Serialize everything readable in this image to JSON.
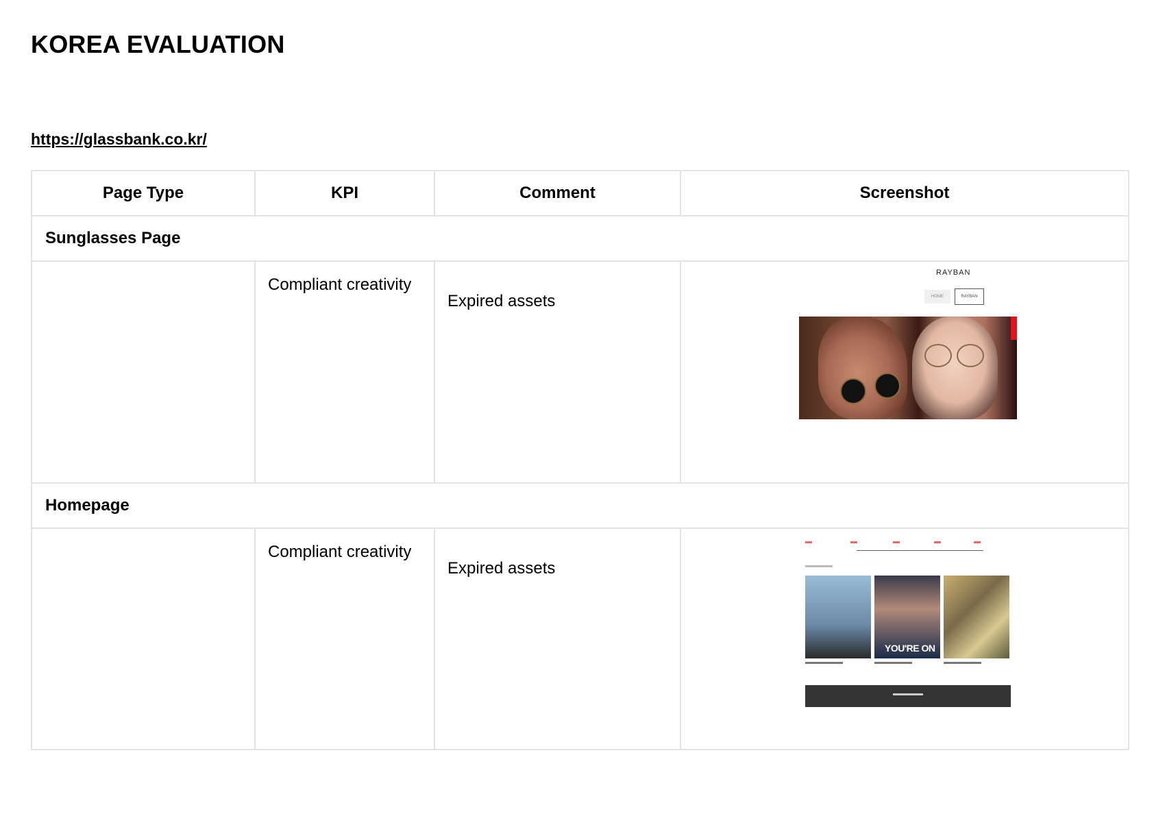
{
  "document": {
    "title": "KOREA EVALUATION",
    "url": "https://glassbank.co.kr/"
  },
  "table": {
    "headers": {
      "page_type": "Page Type",
      "kpi": "KPI",
      "comment": "Comment",
      "screenshot": "Screenshot"
    },
    "sections": [
      {
        "name": "Sunglasses Page",
        "page_type": "",
        "kpi": "Compliant creativity",
        "comment": "Expired assets",
        "screenshot": {
          "brand_text": "RAYBAN",
          "buttons": [
            "HOME",
            "RAYBAN"
          ]
        }
      },
      {
        "name": "Homepage",
        "page_type": "",
        "kpi": "Compliant creativity",
        "comment": "Expired assets",
        "screenshot": {
          "card_overlay_text": "YOU'RE ON"
        }
      }
    ]
  },
  "colors": {
    "border": "#e3e3e3",
    "text": "#000000",
    "accent_red": "#e8101a"
  }
}
